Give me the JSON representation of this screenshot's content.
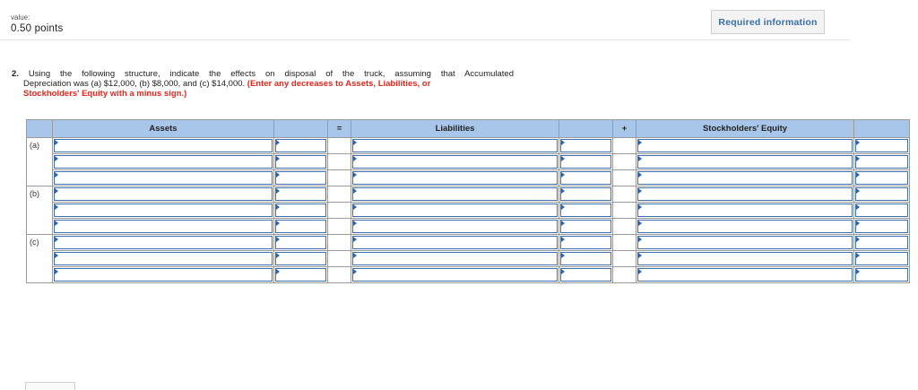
{
  "header": {
    "value_label": "value:",
    "points": "0.50 points",
    "required_info_label": "Required information"
  },
  "question": {
    "number": "2.",
    "line1": "Using the following structure, indicate the effects on disposal of the truck, assuming that Accumulated",
    "line2": "Depreciation was (a) $12,000, (b) $8,000, and (c) $14,000.",
    "instruction_part1": "(Enter any decreases to Assets, Liabilities, or",
    "instruction_part2": "Stockholders' Equity with a minus sign.)"
  },
  "table": {
    "headers": {
      "assets": "Assets",
      "equals": "=",
      "liabilities": "Liabilities",
      "plus": "+",
      "equity": "Stockholders' Equity"
    },
    "row_labels": [
      "(a)",
      "(b)",
      "(c)"
    ]
  }
}
